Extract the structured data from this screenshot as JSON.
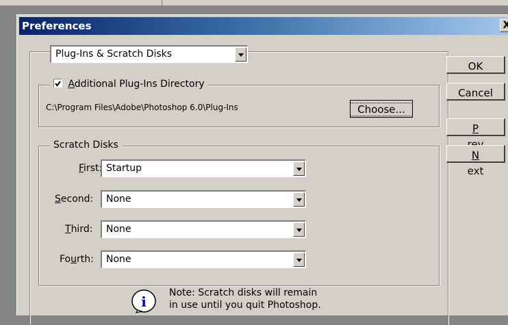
{
  "window": {
    "title": "Preferences",
    "close_glyph": "X"
  },
  "section_select": {
    "selected": "Plug-Ins & Scratch Disks"
  },
  "plugins": {
    "checkbox_label_underline": "A",
    "checkbox_label_rest": "dditional Plug-Ins Directory",
    "checked": true,
    "path": "C:\\Program Files\\Adobe\\Photoshop 6.0\\Plug-Ins",
    "choose_label": "Choose..."
  },
  "scratch": {
    "legend": "Scratch Disks",
    "rows": [
      {
        "label_underline": "F",
        "label_rest": "irst:",
        "value": "Startup"
      },
      {
        "label_underline": "S",
        "label_rest": "econd:",
        "value": "None"
      },
      {
        "label_underline": "T",
        "label_rest": "hird:",
        "value": "None"
      },
      {
        "label_pre": "Fo",
        "label_underline": "u",
        "label_rest": "rth:",
        "value": "None"
      }
    ]
  },
  "note": {
    "line1": "Note: Scratch disks will remain",
    "line2": "in use until you quit Photoshop.",
    "icon": "info-icon"
  },
  "buttons": {
    "ok": "OK",
    "cancel": "Cancel",
    "prev_underline": "P",
    "prev_rest": "rev",
    "next_underline": "N",
    "next_rest": "ext"
  }
}
